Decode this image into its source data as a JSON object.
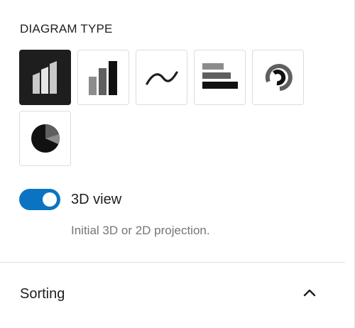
{
  "diagram_type": {
    "label": "DIAGRAM TYPE",
    "options": [
      {
        "icon": "3d-bar-chart-icon",
        "selected": true
      },
      {
        "icon": "bar-chart-icon",
        "selected": false
      },
      {
        "icon": "line-chart-icon",
        "selected": false
      },
      {
        "icon": "horizontal-bar-chart-icon",
        "selected": false
      },
      {
        "icon": "radial-chart-icon",
        "selected": false
      },
      {
        "icon": "pie-chart-icon",
        "selected": false
      }
    ]
  },
  "view_toggle": {
    "label": "3D view",
    "enabled": true,
    "help": "Initial 3D or 2D projection."
  },
  "sorting_panel": {
    "title": "Sorting",
    "expanded": true,
    "icon": "chevron-up-icon"
  },
  "colors": {
    "accent": "#0a74c2",
    "selected_bg": "#1e1e1e",
    "help_text": "#757575"
  }
}
